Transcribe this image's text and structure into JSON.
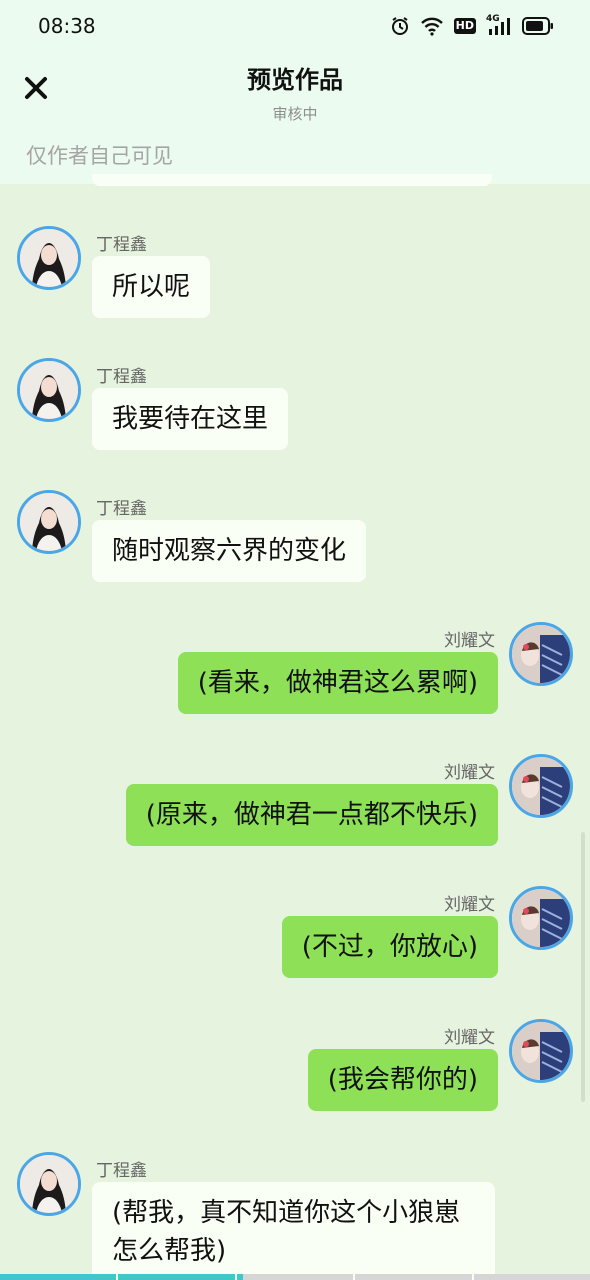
{
  "status_bar": {
    "time": "08:38",
    "network_label": "4G",
    "hd_label": "HD",
    "icons": [
      "alarm-icon",
      "wifi-icon",
      "hd-icon",
      "signal-4g-icon",
      "battery-icon"
    ]
  },
  "header": {
    "close_icon": "close-icon",
    "title": "预览作品",
    "subtitle": "审核中",
    "visibility_note": "仅作者自己可见"
  },
  "colors": {
    "background": "#e6f3de",
    "header_background": "#ecfbef",
    "left_bubble": "#fafff6",
    "right_bubble": "#8ee057",
    "avatar_ring": "#4aa6e6",
    "progress_accent": "#3fc7cc"
  },
  "messages": [
    {
      "side": "left",
      "sender": "丁程鑫",
      "text": "所以呢"
    },
    {
      "side": "left",
      "sender": "丁程鑫",
      "text": "我要待在这里"
    },
    {
      "side": "left",
      "sender": "丁程鑫",
      "text": "随时观察六界的变化"
    },
    {
      "side": "right",
      "sender": "刘耀文",
      "text": "(看来，做神君这么累啊)"
    },
    {
      "side": "right",
      "sender": "刘耀文",
      "text": "(原来，做神君一点都不快乐)"
    },
    {
      "side": "right",
      "sender": "刘耀文",
      "text": "(不过，你放心)"
    },
    {
      "side": "right",
      "sender": "刘耀文",
      "text": "(我会帮你的)"
    },
    {
      "side": "left",
      "sender": "丁程鑫",
      "text": "(帮我，真不知道你这个小狼崽怎么帮我)"
    }
  ],
  "progress": {
    "segments": 5,
    "completed_fraction": 0.41
  }
}
